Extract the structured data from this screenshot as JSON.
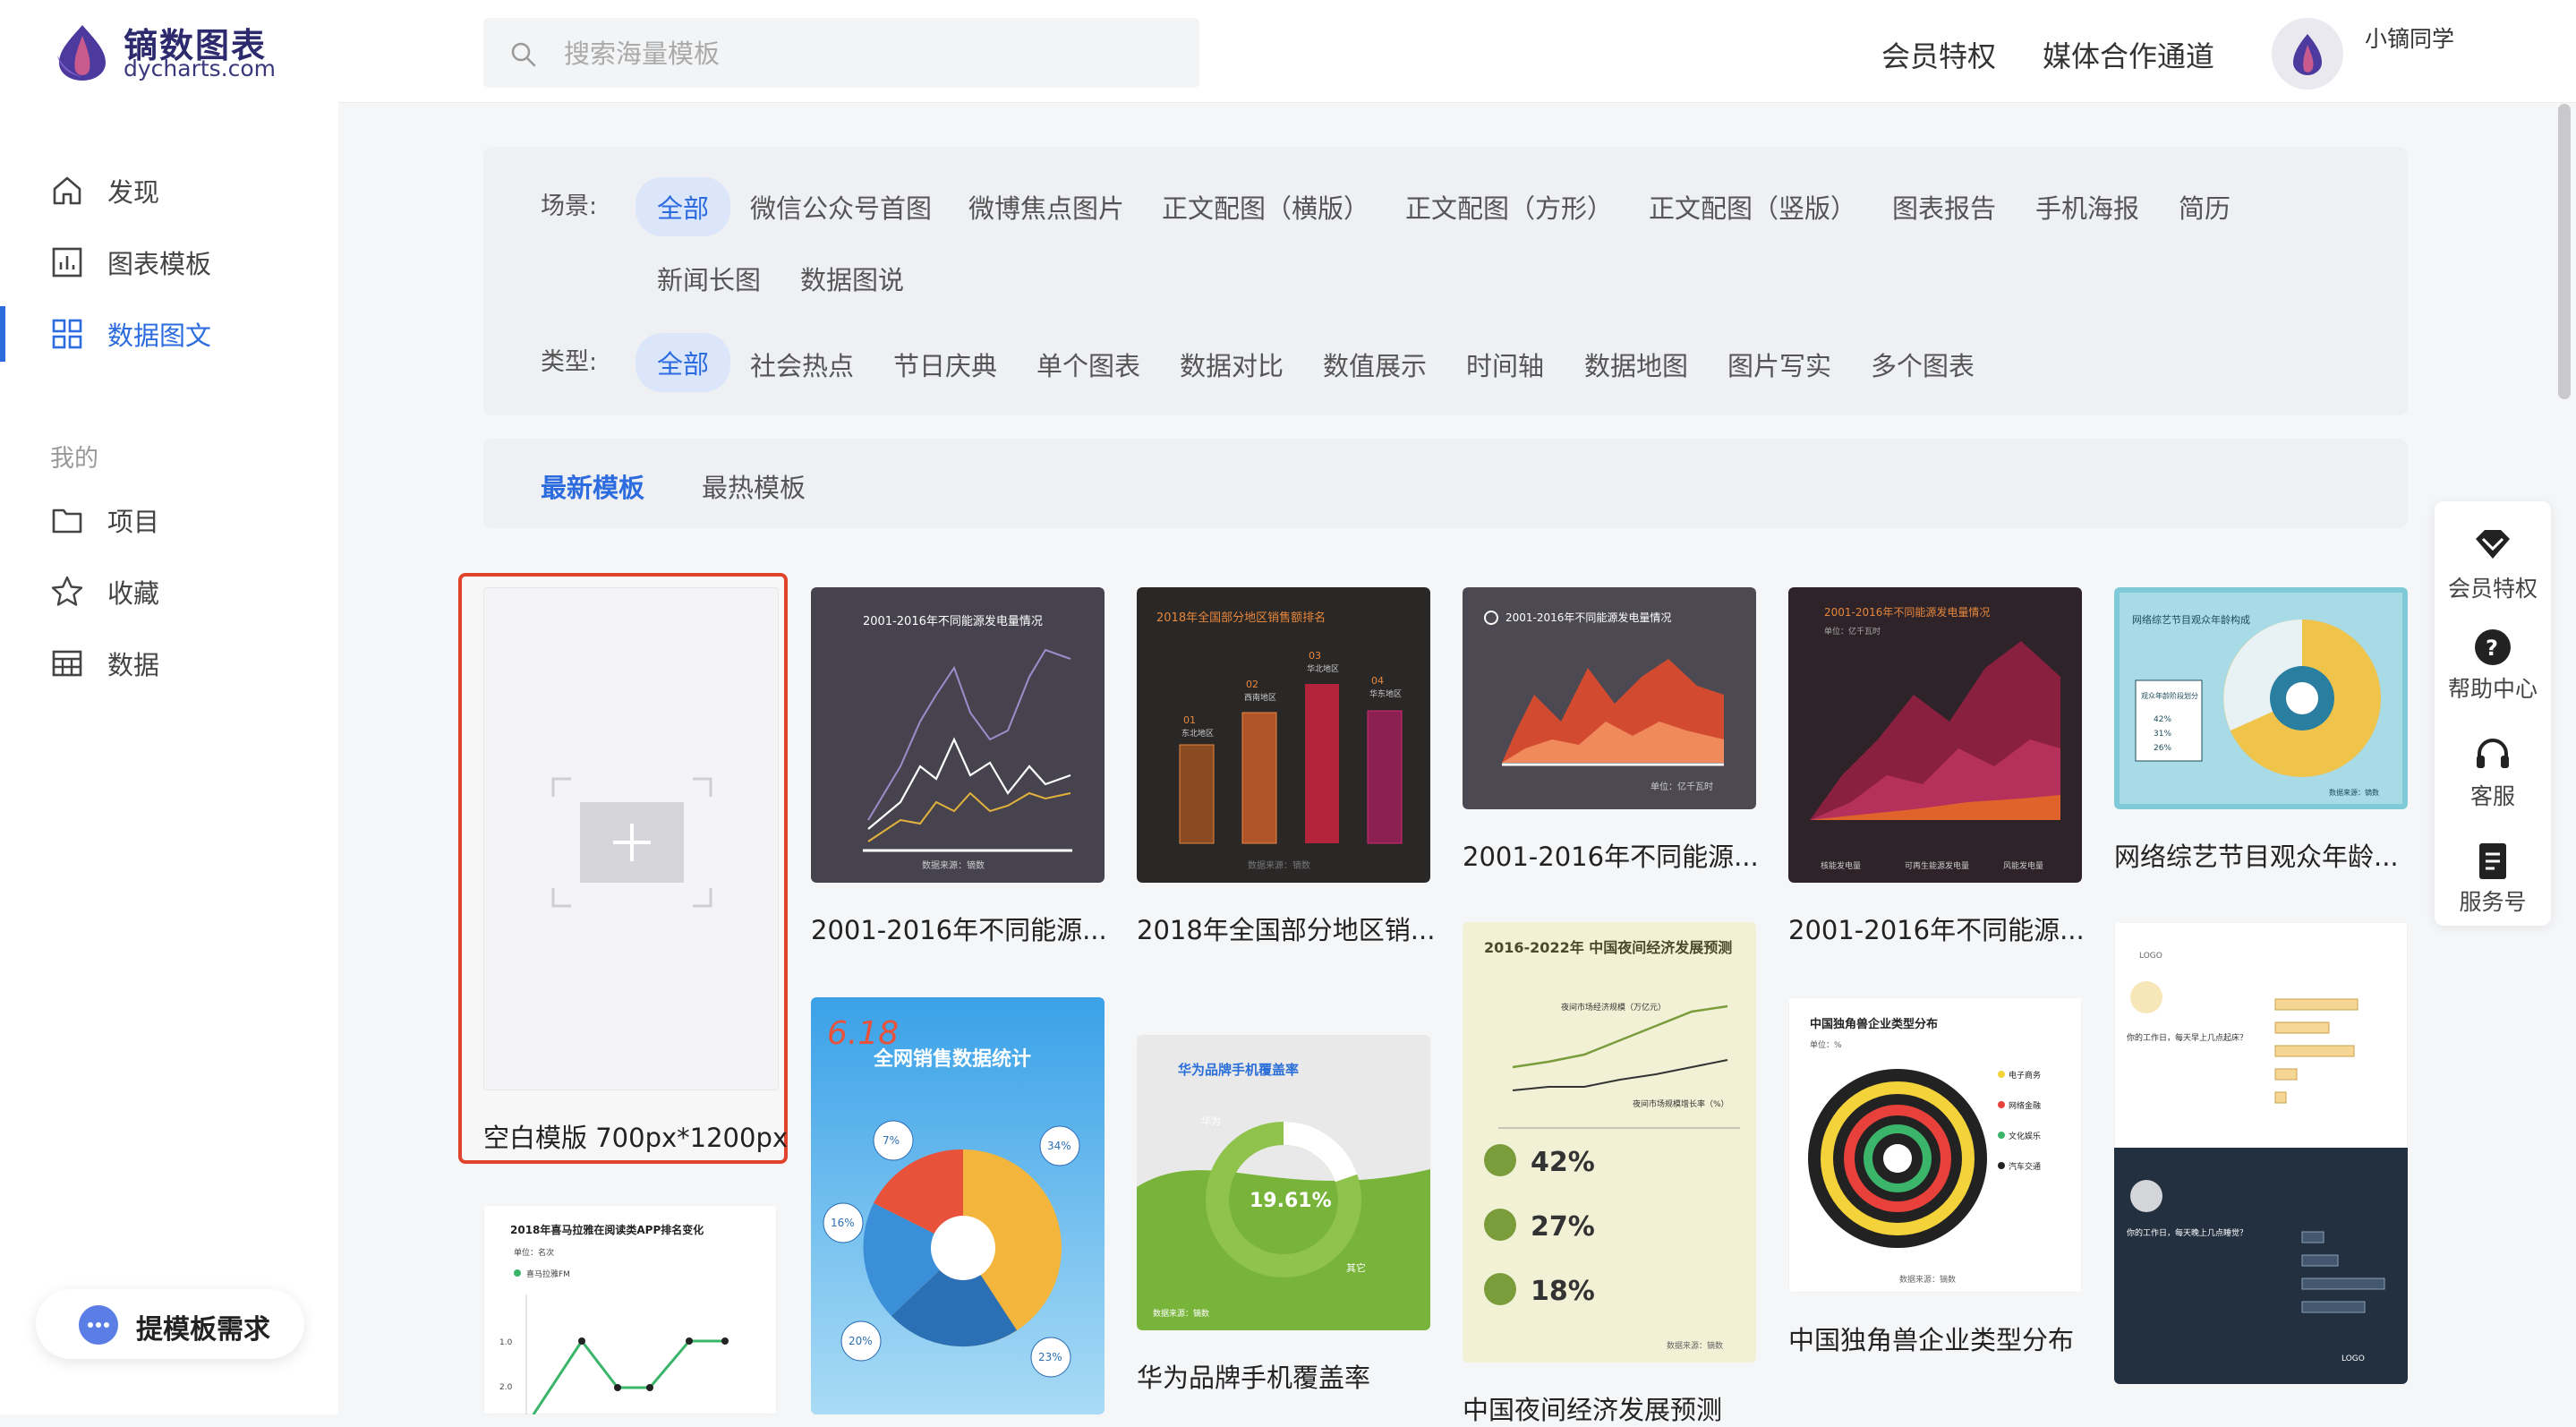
{
  "header": {
    "logo_cn": "镝数图表",
    "logo_en": "dycharts.com",
    "search_placeholder": "搜索海量模板",
    "links": [
      "会员特权",
      "媒体合作通道"
    ],
    "username": "小镝同学"
  },
  "sidebar": {
    "items": [
      {
        "label": "发现",
        "icon": "home-icon"
      },
      {
        "label": "图表模板",
        "icon": "chart-icon"
      },
      {
        "label": "数据图文",
        "icon": "grid-icon",
        "active": true
      }
    ],
    "section": "我的",
    "my_items": [
      {
        "label": "项目",
        "icon": "folder-icon"
      },
      {
        "label": "收藏",
        "icon": "star-icon"
      },
      {
        "label": "数据",
        "icon": "table-icon"
      }
    ],
    "request_button": "提模板需求"
  },
  "filters": {
    "scene_label": "场景:",
    "scene_options": [
      "全部",
      "微信公众号首图",
      "微博焦点图片",
      "正文配图（横版）",
      "正文配图（方形）",
      "正文配图（竖版）",
      "图表报告",
      "手机海报",
      "简历",
      "新闻长图",
      "数据图说"
    ],
    "type_label": "类型:",
    "type_options": [
      "全部",
      "社会热点",
      "节日庆典",
      "单个图表",
      "数据对比",
      "数值展示",
      "时间轴",
      "数据地图",
      "图片写实",
      "多个图表"
    ]
  },
  "tabs": [
    "最新模板",
    "最热模板"
  ],
  "blank_template": "空白模版 700px*1200px",
  "templates": [
    {
      "title": "2001-2016年不同能源...",
      "thumb_title": "2001-2016年不同能源发电量情况",
      "thumb_footer": "数据来源：镝数"
    },
    {
      "title": "2018年全国部分地区销...",
      "thumb_title": "2018年全国部分地区销售额排名",
      "bars": [
        {
          "rank": "01",
          "region": "东北地区"
        },
        {
          "rank": "02",
          "region": "西南地区"
        },
        {
          "rank": "03",
          "region": "华北地区"
        },
        {
          "rank": "04",
          "region": "华东地区"
        }
      ],
      "thumb_footer": "数据来源：镝数"
    },
    {
      "title": "2001-2016年不同能源...",
      "thumb_title": "2001-2016年不同能源发电量情况",
      "thumb_footer": "单位：亿千瓦时"
    },
    {
      "title": "2001-2016年不同能源...",
      "thumb_title": "2001-2016年不同能源发电量情况",
      "thumb_subtitle": "单位：亿千瓦时",
      "legend": [
        "核能发电量",
        "可再生能源发电量",
        "风能发电量"
      ]
    },
    {
      "title": "网络综艺节目观众年龄...",
      "thumb_title": "网络综艺节目观众年龄构成",
      "legend_title": "观众年龄阶段划分",
      "percents": [
        "42%",
        "31%",
        "26%"
      ],
      "thumb_footer": "数据来源：镝数"
    },
    {
      "title": "",
      "thumb_title": "全网销售数据统计",
      "thumb_date": "6.18",
      "percents": [
        "7%",
        "34%",
        "16%",
        "20%",
        "23%"
      ]
    },
    {
      "title": "华为品牌手机覆盖率",
      "thumb_title": "华为品牌手机覆盖率",
      "value": "19.61%",
      "labels": [
        "华为",
        "其它"
      ],
      "thumb_footer": "数据来源：镝数"
    },
    {
      "title": "中国夜间经济发展预测",
      "thumb_title": "2016-2022年 中国夜间经济发展预测",
      "series_labels": [
        "夜间市场经济规模（万亿元）",
        "夜间市场规模增长率（%）"
      ],
      "stats": [
        "42%",
        "27%",
        "18%"
      ],
      "thumb_footer": "数据来源：镝数"
    },
    {
      "title": "中国独角兽企业类型分布",
      "thumb_title": "中国独角兽企业类型分布",
      "thumb_subtitle": "单位：%",
      "legend": [
        "电子商务",
        "网络金融",
        "文化娱乐",
        "汽车交通"
      ],
      "thumb_footer": "数据来源：镝数"
    },
    {
      "title": "",
      "q1": "你的工作日，每天早上几点起床？",
      "q2": "你的工作日，每天晚上几点睡觉？",
      "logo": "LOGO"
    },
    {
      "title": "",
      "thumb_title": "2018年喜马拉雅在阅读类APP排名变化",
      "thumb_subtitle": "单位：名次",
      "legend": [
        "喜马拉雅FM"
      ],
      "y_ticks": [
        "1.0",
        "2.0"
      ]
    }
  ],
  "right_panel": [
    {
      "label": "会员特权",
      "icon": "diamond-icon"
    },
    {
      "label": "帮助中心",
      "icon": "help-icon"
    },
    {
      "label": "客服",
      "icon": "headset-icon"
    },
    {
      "label": "服务号",
      "icon": "document-icon"
    }
  ]
}
